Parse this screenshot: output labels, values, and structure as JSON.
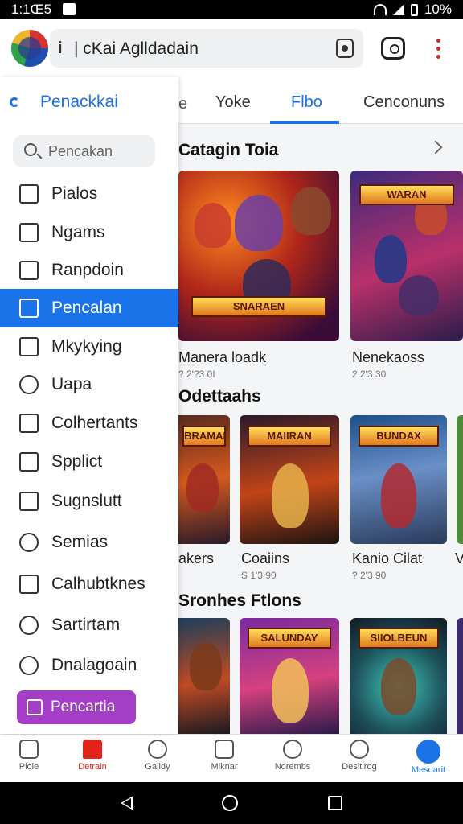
{
  "status": {
    "time": "1:1Œ5",
    "battery": "10%"
  },
  "appbar": {
    "info_glyph": "i",
    "search_text": "| cKai Aglldadain"
  },
  "drawer": {
    "header": "Penackkai",
    "search_placeholder": "Pencakan",
    "items": [
      {
        "label": "Pialos",
        "icon": "columns-icon"
      },
      {
        "label": "Ngams",
        "icon": "share-icon"
      },
      {
        "label": "Ranpdoin",
        "icon": "bookmark-icon"
      },
      {
        "label": "Pencalan",
        "icon": "page-icon",
        "active": true
      },
      {
        "label": "Mkykying",
        "icon": "frame-icon"
      },
      {
        "label": "Uapa",
        "icon": "chat-icon"
      },
      {
        "label": "Colhertants",
        "icon": "edit-icon"
      },
      {
        "label": "Spplict",
        "icon": "pen-icon"
      },
      {
        "label": "Sugnslutt",
        "icon": "slash-icon"
      },
      {
        "label": "Semias",
        "icon": "search-icon"
      },
      {
        "label": "Calhubtknes",
        "icon": "tag-icon"
      },
      {
        "label": "Sartirtam",
        "icon": "clock-icon"
      },
      {
        "label": "Dnalagoain",
        "icon": "timer-icon"
      }
    ],
    "promo": "Pencartia"
  },
  "tabs": {
    "partial": "e",
    "items": [
      "Yoke",
      "Flbo",
      "Cenconuns"
    ],
    "active_index": 1
  },
  "sections": [
    {
      "title": "Catagin Toia",
      "cards": [
        {
          "title": "Manera loadk",
          "meta": "? 2'?3 0I",
          "badge": "SNARAEN"
        },
        {
          "title": "Nenekaoss",
          "meta": "2 2'3 30",
          "badge": "WARAN"
        }
      ]
    },
    {
      "title": "Odettaahs",
      "cards": [
        {
          "title": "akers",
          "meta": "",
          "badge": "BRAMAN"
        },
        {
          "title": "Coaiins",
          "meta": "S 1'3 90",
          "badge": "MAIIRAN"
        },
        {
          "title": "Kanio Cilat",
          "meta": "? 2'3 90",
          "badge": "BUNDAX"
        },
        {
          "title": "V",
          "meta": "",
          "badge": ""
        }
      ]
    },
    {
      "title": "Sronhes Ftlons",
      "cards": [
        {
          "title": "",
          "meta": "",
          "badge": ""
        },
        {
          "title": "",
          "meta": "",
          "badge": "SALUNDAY"
        },
        {
          "title": "",
          "meta": "",
          "badge": "SIIOLBEUN"
        }
      ]
    }
  ],
  "bottom_nav": [
    {
      "label": "Piole",
      "icon": "home-icon"
    },
    {
      "label": "Detrain",
      "icon": "home-filled-icon",
      "accent": "#e3221c"
    },
    {
      "label": "Gaildy",
      "icon": "chat-search-icon"
    },
    {
      "label": "Mlknar",
      "icon": "list-icon"
    },
    {
      "label": "Norembs",
      "icon": "person-icon"
    },
    {
      "label": "Desltirog",
      "icon": "message-icon"
    },
    {
      "label": "Mesoarit",
      "icon": "account-icon",
      "accent": "#1a73e8"
    }
  ],
  "colors": {
    "accent": "#1a73e8",
    "promo": "#a43ec6",
    "red": "#e3221c"
  }
}
